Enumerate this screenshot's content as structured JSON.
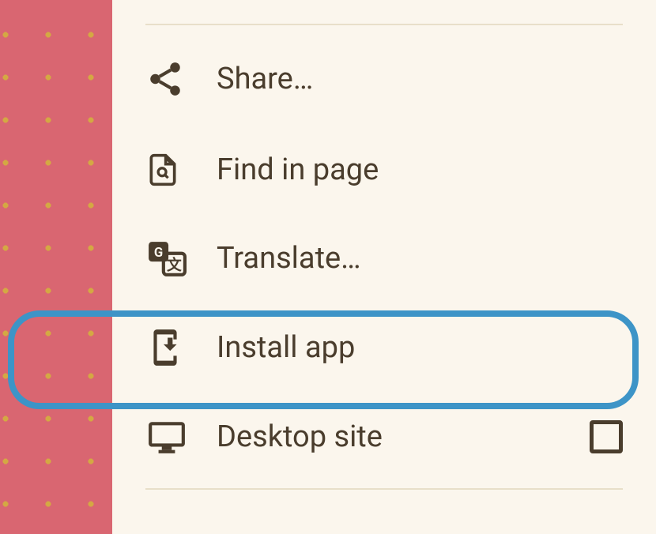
{
  "menu": {
    "items": [
      {
        "label": "Share…",
        "icon": "share-icon"
      },
      {
        "label": "Find in page",
        "icon": "find-icon"
      },
      {
        "label": "Translate…",
        "icon": "translate-icon"
      },
      {
        "label": "Install app",
        "icon": "install-icon"
      },
      {
        "label": "Desktop site",
        "icon": "desktop-icon",
        "hasCheckbox": true,
        "checked": false
      }
    ],
    "highlightedIndex": 3
  },
  "colors": {
    "background": "#d96671",
    "panel": "#fbf6ed",
    "text": "#4a3d2d",
    "dot": "#d4a843",
    "highlight": "#3d94c7",
    "divider": "#e8dfc9"
  }
}
